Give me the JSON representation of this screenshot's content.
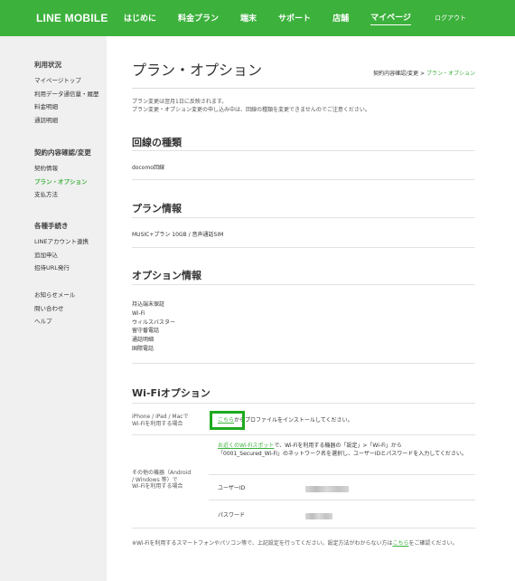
{
  "header": {
    "logo": "LINE MOBILE",
    "nav": [
      "はじめに",
      "料金プラン",
      "端末",
      "サポート",
      "店舗",
      "マイページ"
    ],
    "logout": "ログアウト"
  },
  "sidebar": {
    "groups": [
      {
        "head": "利用状況",
        "items": [
          "マイページトップ",
          "利用データ通信量・履歴",
          "料金明細",
          "通話明細"
        ]
      },
      {
        "head": "契約内容確認/変更",
        "items": [
          "契約情報",
          "プラン・オプション",
          "支払方法"
        ]
      },
      {
        "head": "各種手続き",
        "items": [
          "LINEアカウント連携",
          "追加申込",
          "招待URL発行"
        ]
      },
      {
        "head": "",
        "items": [
          "お知らせメール",
          "問い合わせ",
          "ヘルプ"
        ]
      }
    ]
  },
  "page": {
    "title": "プラン・オプション",
    "breadcrumb_parent": "契約内容確認/変更",
    "breadcrumb_sep": ">",
    "breadcrumb_current": "プラン・オプション",
    "notice_line1": "プラン変更は翌月1日に反映されます。",
    "notice_line2": "プラン変更・オプション変更の申し込み中は、回線の種類を変更できませんのでご注意ください。"
  },
  "line_type": {
    "title": "回線の種類",
    "value": "docomo回線"
  },
  "plan": {
    "title": "プラン情報",
    "value": "MUSIC+プラン 10GB / 音声通話SIM"
  },
  "options": {
    "title": "オプション情報",
    "items": [
      "持込端末保証",
      "Wi-Fi",
      "ウィルスバスター",
      "留守番電話",
      "通話明細",
      "国際電話"
    ]
  },
  "wifi": {
    "title": "Wi-Fiオプション",
    "row1_label_1": "iPhone / iPad / Macで",
    "row1_label_2": "Wi-Fiを利用する場合",
    "row1_link": "こちら",
    "row1_text": "からプロファイルをインストールしてください。",
    "row2_label_1": "その他の機器（Android",
    "row2_label_2": "/ Windows 等）で",
    "row2_label_3": "Wi-Fiを利用する場合",
    "row2_link": "お近くのWi-Fiスポット",
    "row2_text_1": "で、Wi-Fiを利用する機器の「設定」>「Wi-Fi」から",
    "row2_text_2": "「0001_Secured_Wi-Fi」のネットワーク名を選択し、ユーザーIDとパスワードを入力してください。",
    "user_id_label": "ユーザーID",
    "password_label": "パスワード",
    "footnote_pre": "※Wi-Fiを利用するスマートフォンやパソコン等で、上記設定を行ってください。設定方法がわからない方は",
    "footnote_link": "こちら",
    "footnote_post": "をご確認ください。"
  },
  "colors": {
    "brand_green": "#3cb13c",
    "highlight_green": "#1faa1f"
  }
}
